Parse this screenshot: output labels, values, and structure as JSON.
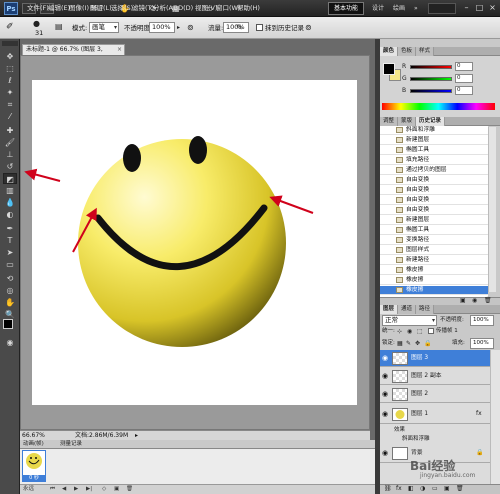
{
  "app": {
    "logo": "Ps",
    "zoom_menu": "66.7",
    "menu": [
      "文件(F)",
      "编辑(E)",
      "图像(I)",
      "图层(L)",
      "选择(S)",
      "滤镜(T)",
      "分析(A)",
      "3D(D)",
      "视图(V)",
      "窗口(W)",
      "帮助(H)"
    ],
    "workspaces": {
      "active": "基本功能",
      "others": [
        "设计",
        "绘画"
      ],
      "more": "»"
    }
  },
  "options": {
    "brush_size": "31",
    "mode_label": "模式:",
    "mode_value": "画笔",
    "opacity_label": "不透明度:",
    "opacity_value": "100%",
    "flow_label": "流量:",
    "flow_value": "100%",
    "erase_to_history": "抹到历史记录"
  },
  "document": {
    "tab_title": "未标题-1 @ 66.7% (图层 3, RGB/8) *",
    "zoom": "66.67%",
    "doc_info": "文档:2.86M/6.39M"
  },
  "animation": {
    "tabs": [
      "动画(帧)",
      "测量记录"
    ],
    "frame_label": "0 秒",
    "loop": "永远"
  },
  "color_panel": {
    "tabs": [
      "颜色",
      "色板",
      "样式"
    ],
    "channels": [
      {
        "label": "R",
        "value": "0",
        "color": "#e02020"
      },
      {
        "label": "G",
        "value": "0",
        "color": "#20a020"
      },
      {
        "label": "B",
        "value": "0",
        "color": "#2040d0"
      }
    ],
    "foreground": "#000000",
    "background": "#f6e889"
  },
  "history_panel": {
    "tabs": [
      "调整",
      "蒙版",
      "历史记录"
    ],
    "items": [
      "斜面和浮雕",
      "新建图层",
      "椭圆工具",
      "填充路径",
      "通过拷贝的图层",
      "自由变换",
      "自由变换",
      "自由变换",
      "自由变换",
      "新建图层",
      "椭圆工具",
      "变换路径",
      "图层样式",
      "新建路径",
      "橡皮擦",
      "橡皮擦",
      "橡皮擦"
    ],
    "selected_index": 16
  },
  "layers_panel": {
    "tabs": [
      "图层",
      "通道",
      "路径"
    ],
    "blend_mode": "正常",
    "opacity_label": "不透明度:",
    "opacity_value": "100%",
    "unify_label": "统一:",
    "propagate": "传播帧 1",
    "lock_label": "锁定:",
    "fill_label": "填充:",
    "fill_value": "100%",
    "layers": [
      {
        "name": "图层 3",
        "selected": true
      },
      {
        "name": "图层 2 副本",
        "selected": false
      },
      {
        "name": "图层 2",
        "selected": false
      },
      {
        "name": "图层 1",
        "selected": false
      }
    ],
    "effects_label": "效果",
    "effect_item": "斜面和浮雕",
    "background_layer": "背景",
    "accent": "#3f7fd8"
  },
  "watermark": "Bai经验",
  "watermark_url": "jingyan.baidu.com"
}
